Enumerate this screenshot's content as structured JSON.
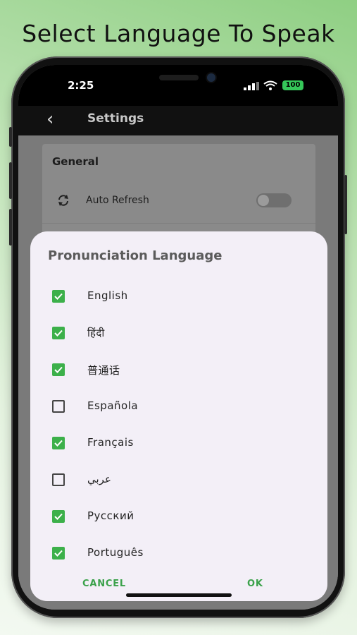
{
  "headline": "Select Language To Speak",
  "status": {
    "time": "2:25",
    "battery": "100"
  },
  "nav": {
    "back_icon": "chevron-left-icon",
    "title": "Settings"
  },
  "settings": {
    "section_title": "General",
    "auto_refresh_label": "Auto Refresh",
    "auto_refresh_on": false
  },
  "dialog": {
    "title": "Pronunciation Language",
    "options": [
      {
        "label": "English",
        "checked": true
      },
      {
        "label": "हिंदी",
        "checked": true
      },
      {
        "label": "普通话",
        "checked": true
      },
      {
        "label": "Española",
        "checked": false
      },
      {
        "label": "Français",
        "checked": true
      },
      {
        "label": "عربي",
        "checked": false
      },
      {
        "label": "Русский",
        "checked": true
      },
      {
        "label": "Português",
        "checked": true
      }
    ],
    "cancel_label": "CANCEL",
    "ok_label": "OK"
  },
  "colors": {
    "accent": "#3cb04a",
    "dialog_bg": "#f3eff7"
  }
}
